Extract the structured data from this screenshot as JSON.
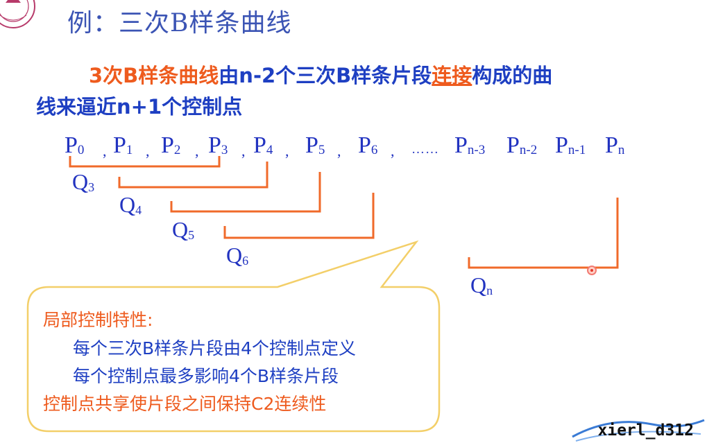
{
  "title": "例：三次B样条曲线",
  "intro": {
    "line1_part1": "3次B样条曲线",
    "line1_part2": "由n-2个三次B样条片段",
    "line1_part3": "连接",
    "line1_part4": "构成的曲",
    "line2": "线来逼近n+1个控制点"
  },
  "points": [
    {
      "base": "P",
      "sub": "0"
    },
    {
      "base": "P",
      "sub": "1"
    },
    {
      "base": "P",
      "sub": "2"
    },
    {
      "base": "P",
      "sub": "3"
    },
    {
      "base": "P",
      "sub": "4"
    },
    {
      "base": "P",
      "sub": "5"
    },
    {
      "base": "P",
      "sub": "6"
    },
    {
      "base": "P",
      "sub": "n-3"
    },
    {
      "base": "P",
      "sub": "n-2"
    },
    {
      "base": "P",
      "sub": "n-1"
    },
    {
      "base": "P",
      "sub": "n"
    }
  ],
  "separators": [
    ",",
    ",",
    ",",
    ",",
    ",",
    ",",
    ","
  ],
  "ellipsis": "……",
  "segments": [
    {
      "base": "Q",
      "sub": "3"
    },
    {
      "base": "Q",
      "sub": "4"
    },
    {
      "base": "Q",
      "sub": "5"
    },
    {
      "base": "Q",
      "sub": "6"
    },
    {
      "base": "Q",
      "sub": "n"
    }
  ],
  "callout": {
    "title": "局部控制特性:",
    "line1": "每个三次B样条片段由4个控制点定义",
    "line2": "每个控制点最多影响4个B样条片段",
    "line3": "控制点共享使片段之间保持C2连续性"
  },
  "watermark": "xierl_d312",
  "colors": {
    "title": "#3b54b4",
    "text_blue": "#1e3fc2",
    "accent_orange": "#ee5b1e",
    "bracket": "#f06a2a",
    "callout_border": "#f3cf69"
  }
}
